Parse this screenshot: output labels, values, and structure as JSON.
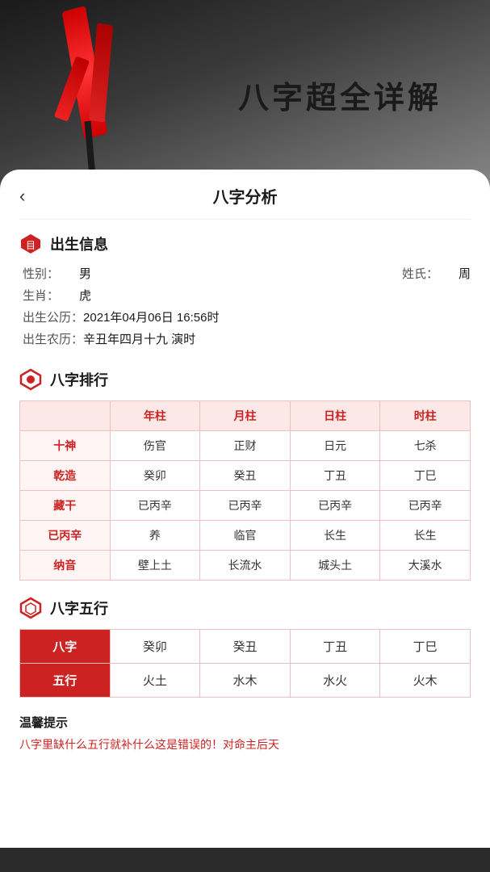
{
  "banner": {
    "title": "八字超全详解"
  },
  "nav": {
    "back": "‹",
    "title": "八字分析"
  },
  "birth_info": {
    "section_title": "出生信息",
    "gender_label": "性别：",
    "gender_value": "男",
    "surname_label": "姓氏：",
    "surname_value": "周",
    "zodiac_label": "生肖：",
    "zodiac_value": "虎",
    "solar_label": "出生公历：",
    "solar_value": "2021年04月06日 16:56时",
    "lunar_label": "出生农历：",
    "lunar_value": "辛丑年四月十九 演时"
  },
  "bazi_rank": {
    "section_title": "八字排行",
    "headers": [
      "",
      "年柱",
      "月柱",
      "日柱",
      "时柱"
    ],
    "rows": [
      [
        "十神",
        "伤官",
        "正财",
        "日元",
        "七杀"
      ],
      [
        "乾造",
        "癸卯",
        "癸丑",
        "丁丑",
        "丁巳"
      ],
      [
        "藏干",
        "已丙辛",
        "已丙辛",
        "已丙辛",
        "已丙辛"
      ],
      [
        "已丙辛",
        "养",
        "临官",
        "长生",
        "长生"
      ],
      [
        "纳音",
        "壁上土",
        "长流水",
        "城头土",
        "大溪水"
      ]
    ]
  },
  "wuxing": {
    "section_title": "八字五行",
    "row1_header": "八字",
    "row2_header": "五行",
    "cells_row1": [
      "癸卯",
      "癸丑",
      "丁丑",
      "丁巳"
    ],
    "cells_row2": [
      "火土",
      "水木",
      "水火",
      "火木"
    ]
  },
  "tip": {
    "title": "温馨提示",
    "text": "八字里缺什么五行就补什么这是错误的！对命主后天"
  }
}
